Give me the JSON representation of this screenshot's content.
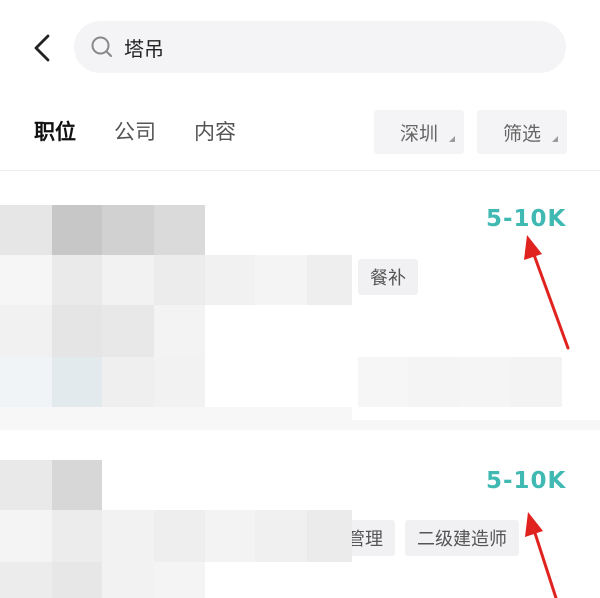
{
  "header": {
    "back_icon": "chevron-left-icon",
    "search_icon": "search-icon",
    "search_value": "塔吊"
  },
  "tabs": [
    {
      "label": "职位",
      "active": true
    },
    {
      "label": "公司",
      "active": false
    },
    {
      "label": "内容",
      "active": false
    }
  ],
  "filters": {
    "city": "深圳",
    "filter": "筛选"
  },
  "jobs": [
    {
      "salary": "5-10K",
      "tags": [
        "餐补"
      ]
    },
    {
      "salary": "5-10K",
      "tags": [
        "管理",
        "二级建造师"
      ]
    }
  ],
  "colors": {
    "salary": "#3fb9b2",
    "annotation_arrow": "#e0231f",
    "search_bg": "#f4f4f6"
  }
}
